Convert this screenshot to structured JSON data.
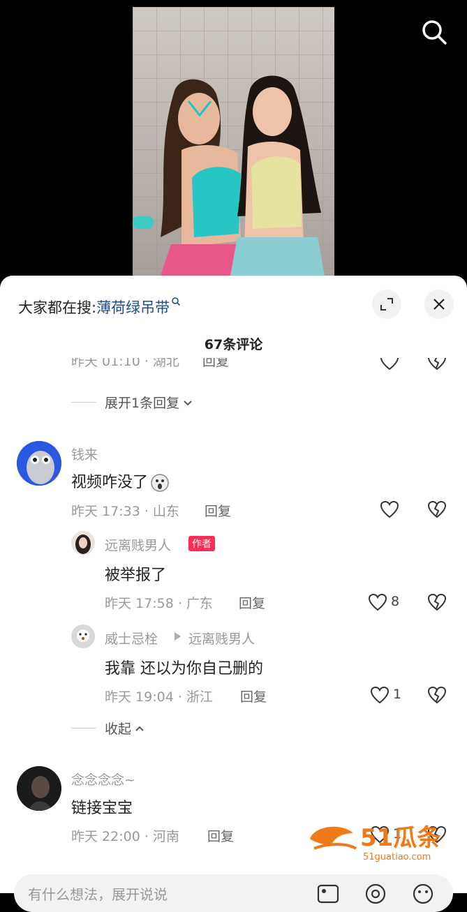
{
  "video": {
    "search_icon": "search-icon"
  },
  "sheet": {
    "hot_search_prefix": "大家都在搜:",
    "hot_search_keyword": "薄荷绿吊带",
    "comment_count": "67条评论",
    "partial_meta": "昨天 01:10 · 湖北",
    "partial_reply": "回复",
    "expand_label": "展开1条回复"
  },
  "comments": [
    {
      "user": "钱来",
      "text": "视频咋没了",
      "meta": "昨天 17:33 · 山东",
      "reply_label": "回复",
      "replies": [
        {
          "user": "远离贱男人",
          "badge": "作者",
          "text": "被举报了",
          "meta": "昨天 17:58 · 广东",
          "reply_label": "回复",
          "likes": "8"
        },
        {
          "user": "威士忌栓",
          "reply_to": "远离贱男人",
          "text": "我靠 还以为你自己删的",
          "meta": "昨天 19:04 · 浙江",
          "reply_label": "回复",
          "likes": "1"
        }
      ],
      "collapse_label": "收起"
    },
    {
      "user": "念念念念~",
      "text": "链接宝宝",
      "meta": "昨天 22:00 · 河南",
      "reply_label": "回复",
      "likes": "1"
    }
  ],
  "watermark": {
    "brand": "51瓜条",
    "url": "51guatiao.com"
  },
  "input": {
    "placeholder": "有什么想法，展开说说"
  },
  "colors": {
    "author_badge": "#fe2c55",
    "keyword": "#1f4d8c",
    "watermark": "#f07a1a"
  }
}
